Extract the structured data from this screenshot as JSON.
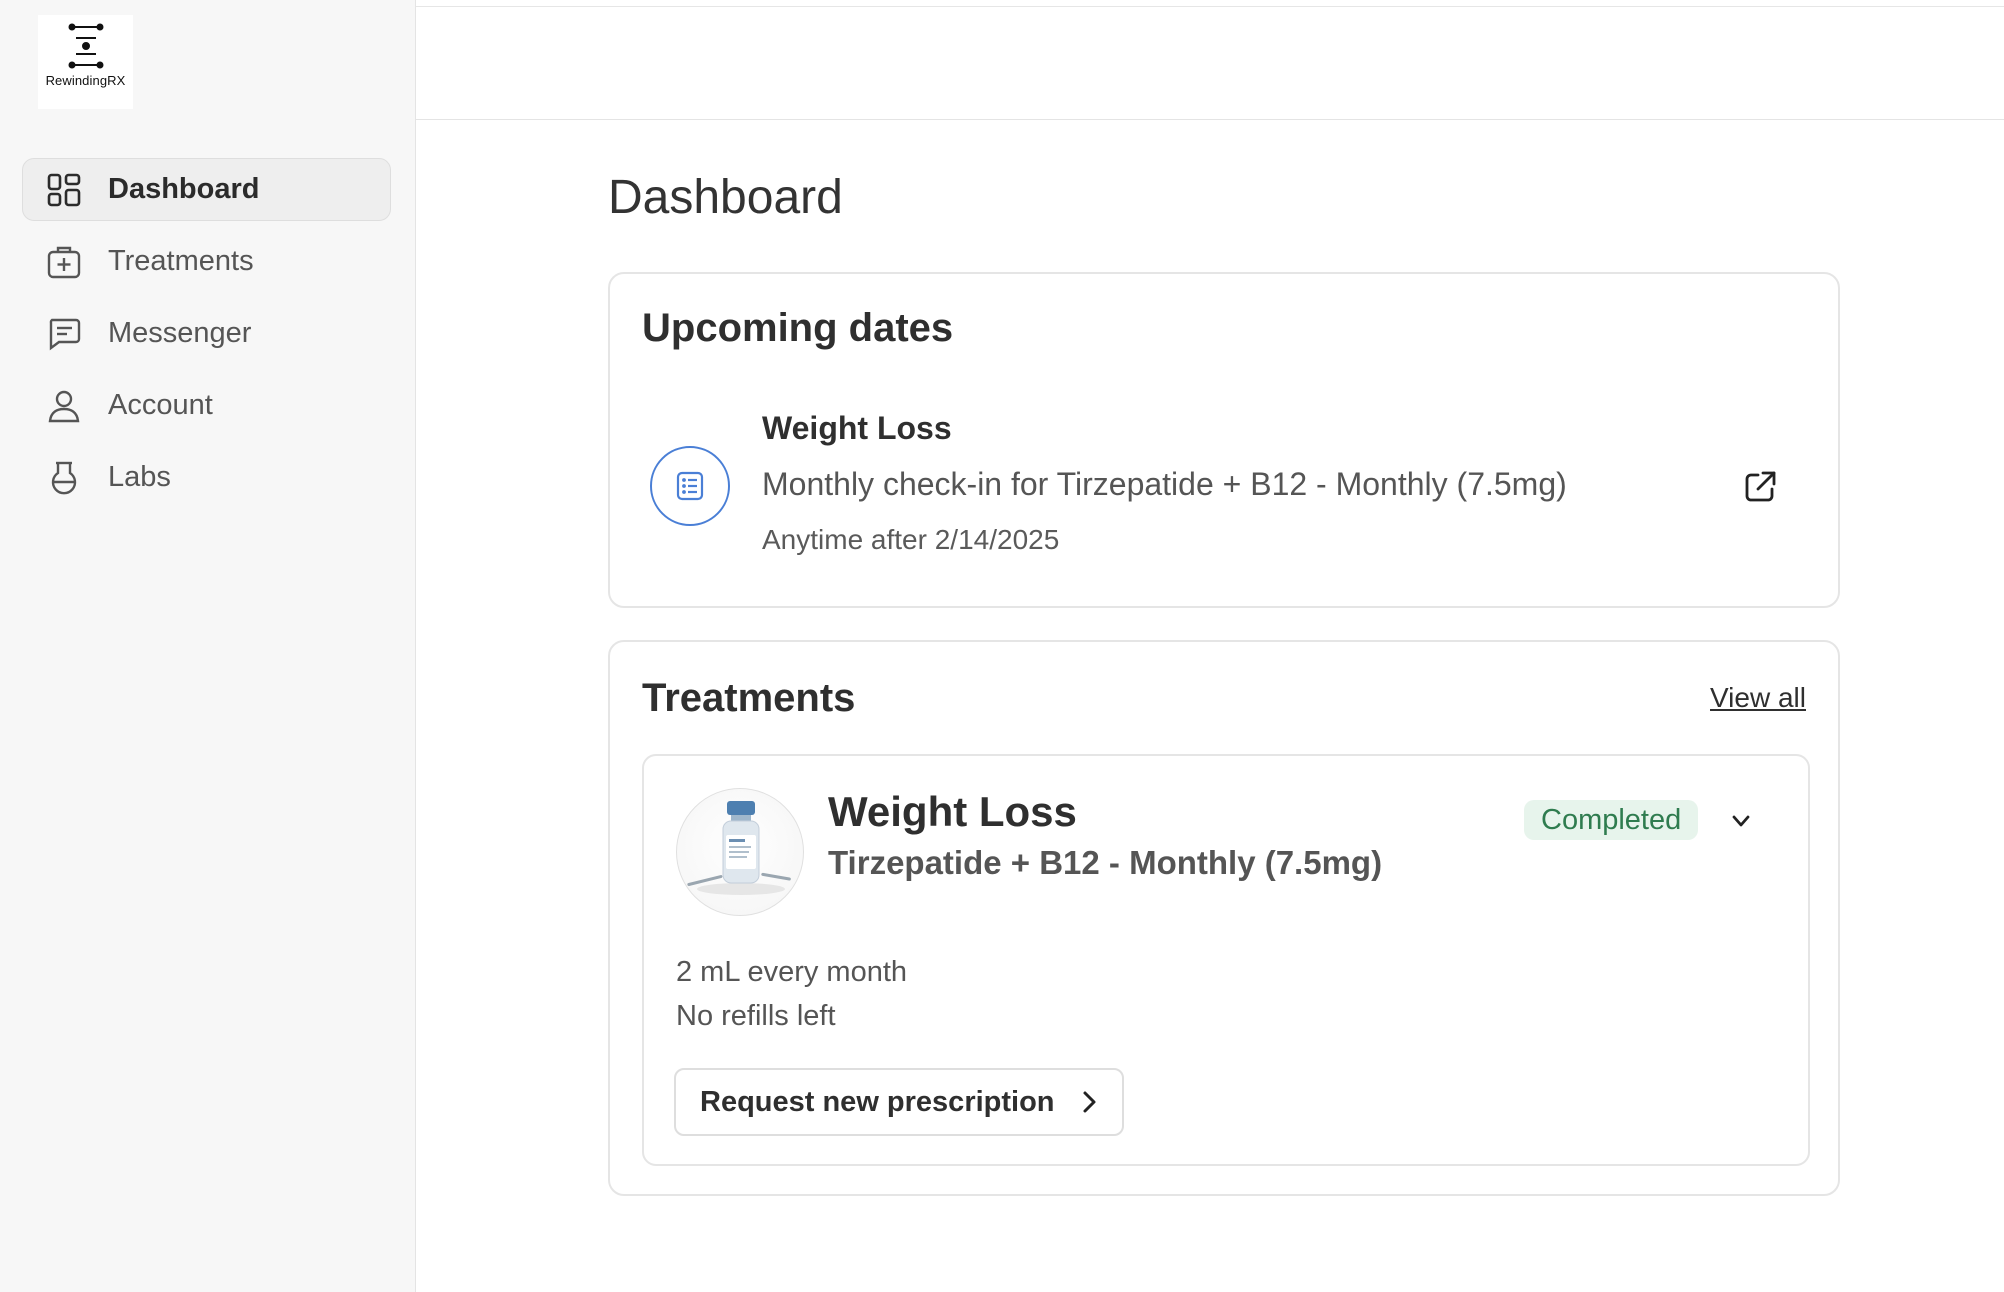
{
  "brand": {
    "name": "RewindingRX",
    "icon": "dna-logo-icon"
  },
  "sidebar": {
    "items": [
      {
        "label": "Dashboard",
        "icon": "dashboard-grid-icon",
        "active": true
      },
      {
        "label": "Treatments",
        "icon": "medical-bag-icon",
        "active": false
      },
      {
        "label": "Messenger",
        "icon": "message-icon",
        "active": false
      },
      {
        "label": "Account",
        "icon": "user-icon",
        "active": false
      },
      {
        "label": "Labs",
        "icon": "flask-icon",
        "active": false
      }
    ]
  },
  "main": {
    "title": "Dashboard",
    "upcoming": {
      "title": "Upcoming dates",
      "event": {
        "title": "Weight Loss",
        "description": "Monthly check-in for Tirzepatide + B12 - Monthly (7.5mg)",
        "date": "Anytime after 2/14/2025",
        "icon": "form-list-icon",
        "link_icon": "external-link-icon"
      }
    },
    "treatments": {
      "title": "Treatments",
      "view_all": "View all",
      "item": {
        "name": "Weight Loss",
        "drug": "Tirzepatide + B12 - Monthly (7.5mg)",
        "status": "Completed",
        "dose": "2 mL every month",
        "refills": "No refills left",
        "action": "Request new prescription"
      }
    }
  },
  "colors": {
    "accent_blue": "#4a7fd6",
    "status_green_bg": "#e7f4ec",
    "status_green_text": "#2f7c4f",
    "sidebar_bg": "#f7f7f7"
  }
}
